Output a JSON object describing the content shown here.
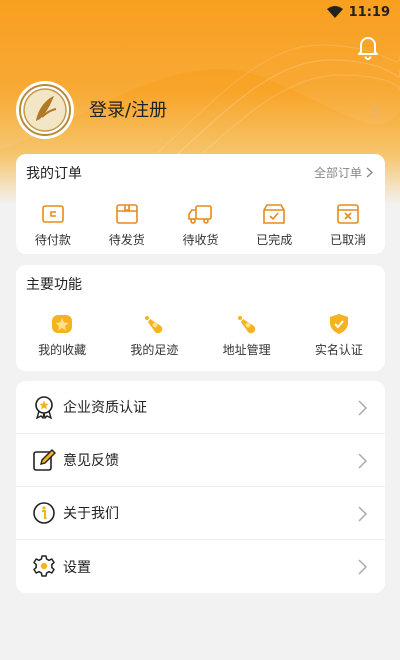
{
  "status_bar": {
    "time": "11:19"
  },
  "profile": {
    "login_label": "登录/注册"
  },
  "orders": {
    "title": "我的订单",
    "all_link": "全部订单",
    "items": [
      {
        "label": "待付款",
        "icon": "wallet-icon"
      },
      {
        "label": "待发货",
        "icon": "box-icon"
      },
      {
        "label": "待收货",
        "icon": "truck-icon"
      },
      {
        "label": "已完成",
        "icon": "box-check-icon"
      },
      {
        "label": "已取消",
        "icon": "box-cancel-icon"
      }
    ]
  },
  "features": {
    "title": "主要功能",
    "items": [
      {
        "label": "我的收藏",
        "icon": "star-icon"
      },
      {
        "label": "我的足迹",
        "icon": "footprint-icon"
      },
      {
        "label": "地址管理",
        "icon": "location-icon"
      },
      {
        "label": "实名认证",
        "icon": "shield-check-icon"
      }
    ]
  },
  "menu": {
    "items": [
      {
        "label": "企业资质认证",
        "icon": "badge-star-icon"
      },
      {
        "label": "意见反馈",
        "icon": "edit-icon"
      },
      {
        "label": "关于我们",
        "icon": "info-icon"
      },
      {
        "label": "设置",
        "icon": "gear-icon"
      }
    ]
  },
  "colors": {
    "accent": "#f89a12",
    "icon_orange": "#e88a1a",
    "icon_gold": "#f5b320",
    "background": "#f2f2f2"
  }
}
